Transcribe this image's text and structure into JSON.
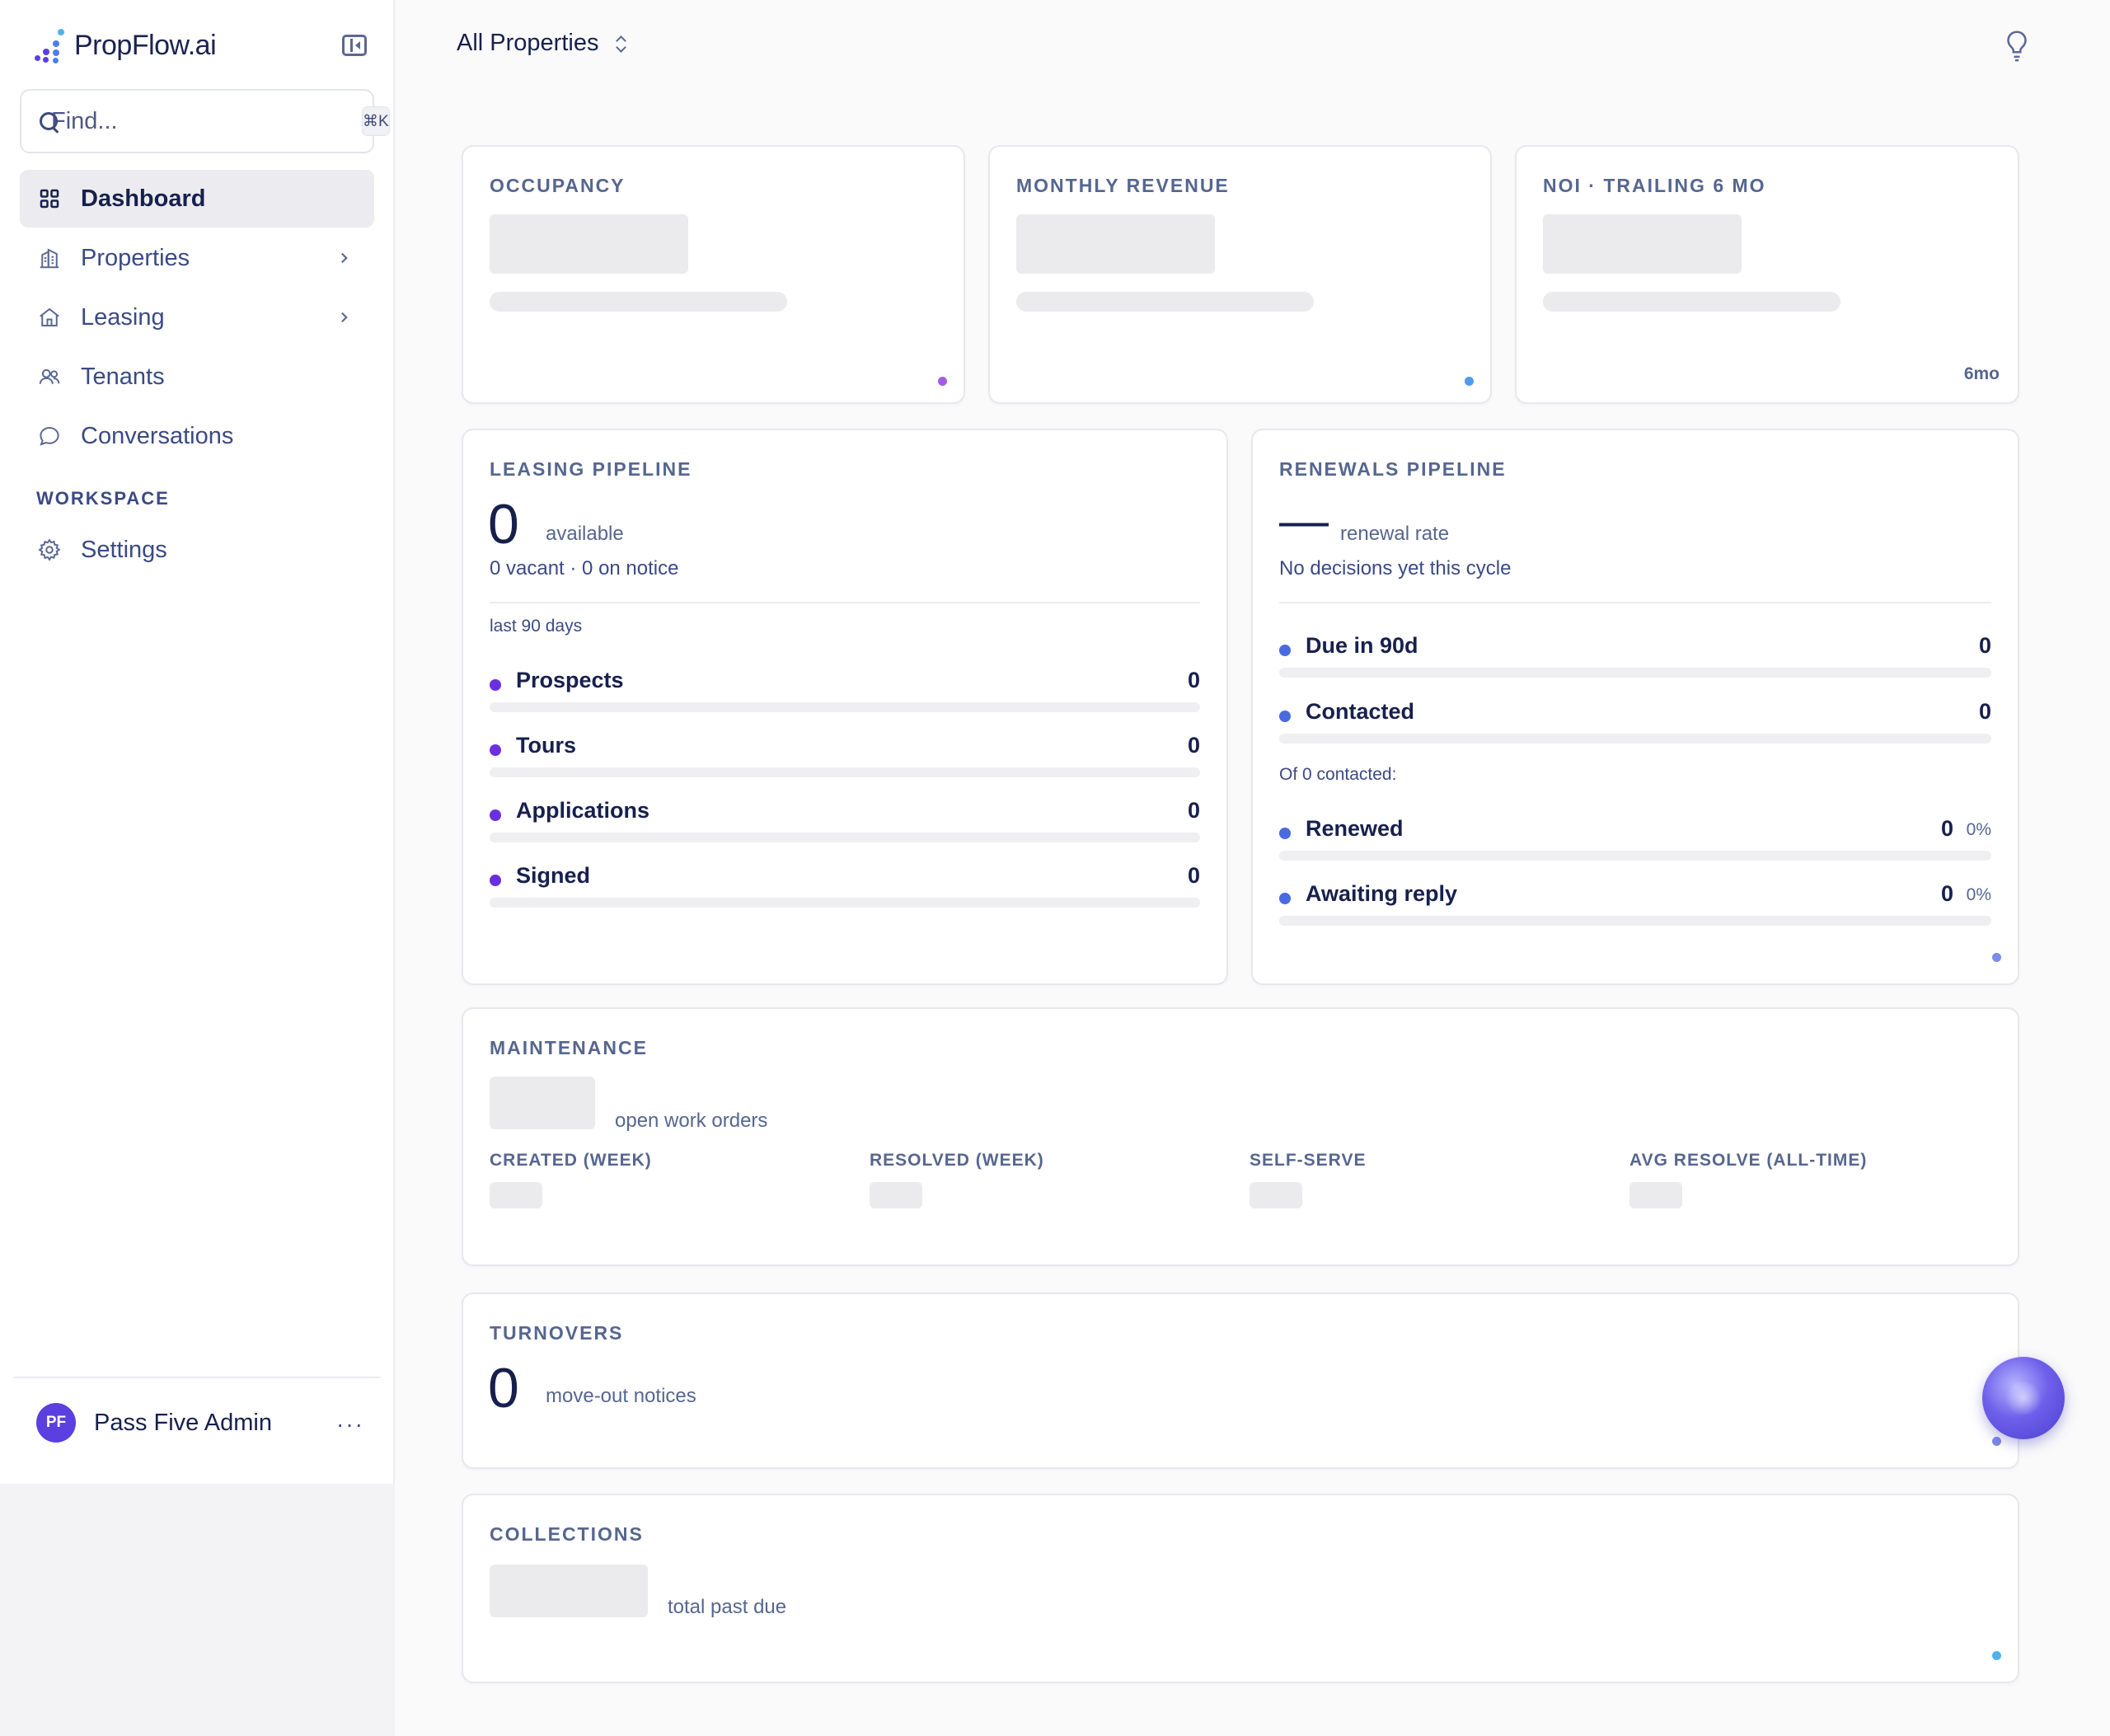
{
  "sidebar": {
    "brand": "PropFlow.ai",
    "search": {
      "placeholder": "Find...",
      "shortcut": "⌘K"
    },
    "items": [
      {
        "label": "Dashboard",
        "icon": "grid-icon",
        "active": true
      },
      {
        "label": "Properties",
        "icon": "building-icon"
      },
      {
        "label": "Leasing",
        "icon": "house-icon"
      },
      {
        "label": "Tenants",
        "icon": "users-icon"
      },
      {
        "label": "Conversations",
        "icon": "chat-bubble-icon"
      }
    ],
    "section_label": "WORKSPACE",
    "workspace_items": [
      {
        "label": "Settings",
        "icon": "gear-icon"
      }
    ],
    "user": {
      "initials": "PF",
      "name": "Pass Five Admin",
      "menu": "···"
    }
  },
  "topbar": {
    "property_selector": "All Properties",
    "icon": "lightbulb-icon"
  },
  "cards": {
    "occupancy": {
      "title": "OCCUPANCY",
      "dot_color": "#a05de6"
    },
    "revenue": {
      "title": "MONTHLY REVENUE",
      "dot_color": "#4f9be8"
    },
    "noi": {
      "title": "NOI · TRAILING 6 MO",
      "period": "6mo"
    },
    "leasing": {
      "title": "LEASING PIPELINE",
      "value": "0",
      "value_label": "available",
      "subtext": "0 vacant · 0 on notice",
      "period": "last 90 days",
      "dot_color": "#6a2fe0",
      "rows": [
        {
          "label": "Prospects",
          "value": "0",
          "fraction": 0
        },
        {
          "label": "Tours",
          "value": "0",
          "fraction": 0
        },
        {
          "label": "Applications",
          "value": "0",
          "fraction": 0
        },
        {
          "label": "Signed",
          "value": "0",
          "fraction": 0
        }
      ]
    },
    "renewals": {
      "title": "RENEWALS PIPELINE",
      "value": "—",
      "value_label": "renewal rate",
      "subtext": "No decisions yet this cycle",
      "dot_color": "#4a6ae0",
      "rows_top": [
        {
          "label": "Due in 90d",
          "value": "0",
          "fraction": 0
        },
        {
          "label": "Contacted",
          "value": "0",
          "fraction": 0
        }
      ],
      "contacted_label": "Of 0 contacted:",
      "rows_bottom": [
        {
          "label": "Renewed",
          "value": "0",
          "pct": "0%",
          "fraction": 0
        },
        {
          "label": "Awaiting reply",
          "value": "0",
          "pct": "0%",
          "fraction": 0
        }
      ],
      "corner_dot_color": "#7a8bea"
    },
    "maintenance": {
      "title": "MAINTENANCE",
      "value_label": "open work orders",
      "stats": [
        {
          "label": "CREATED (WEEK)"
        },
        {
          "label": "RESOLVED (WEEK)"
        },
        {
          "label": "SELF-SERVE"
        },
        {
          "label": "AVG RESOLVE (ALL-TIME)"
        }
      ]
    },
    "turnovers": {
      "title": "TURNOVERS",
      "value": "0",
      "value_label": "move-out notices",
      "dot_color": "#7a8bea"
    },
    "collections": {
      "title": "COLLECTIONS",
      "value_label": "total past due",
      "dot_color": "#4fb2e8"
    }
  }
}
